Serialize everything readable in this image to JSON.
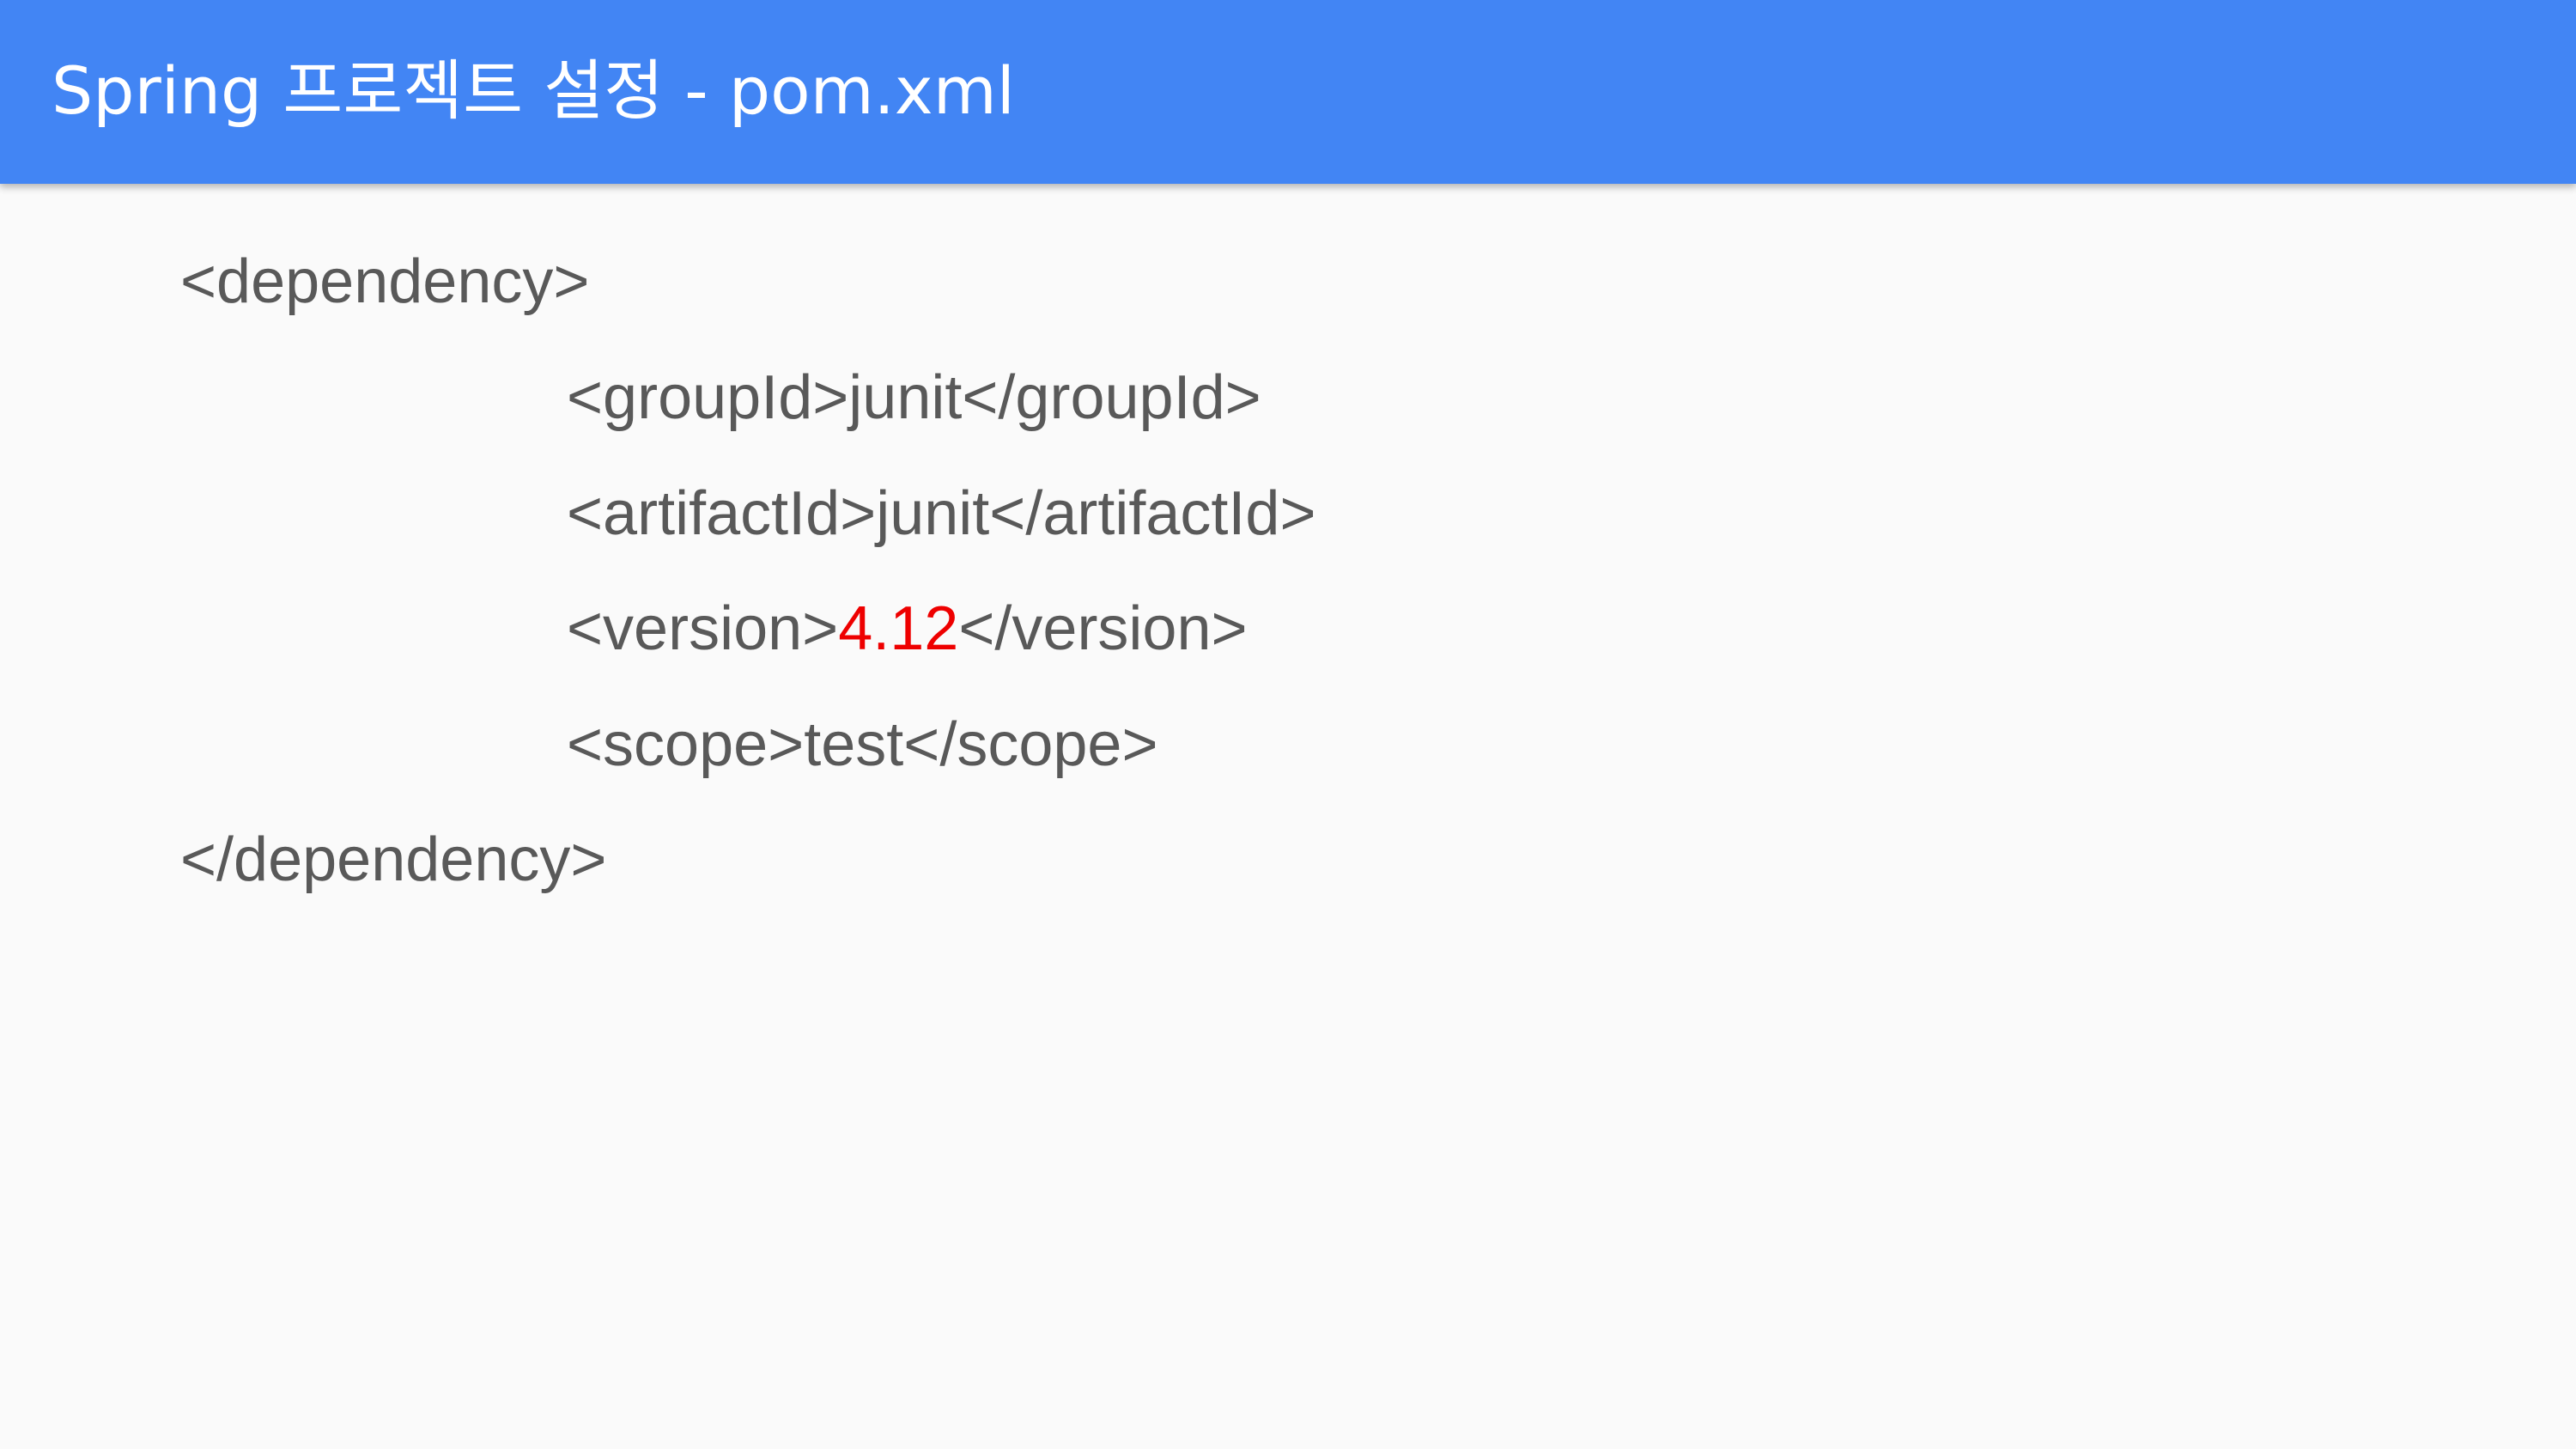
{
  "slide": {
    "title": "Spring 프로젝트 설정 - pom.xml",
    "accent_color": "#4285f4",
    "highlight_color": "#ee0000"
  },
  "code": {
    "dependency_open": "<dependency>",
    "group_id": "<groupId>junit</groupId>",
    "artifact_id": "<artifactId>junit</artifactId>",
    "version_open": "<version>",
    "version_value": "4.12",
    "version_close": "</version>",
    "scope": "<scope>test</scope>",
    "dependency_close": "</dependency>"
  }
}
